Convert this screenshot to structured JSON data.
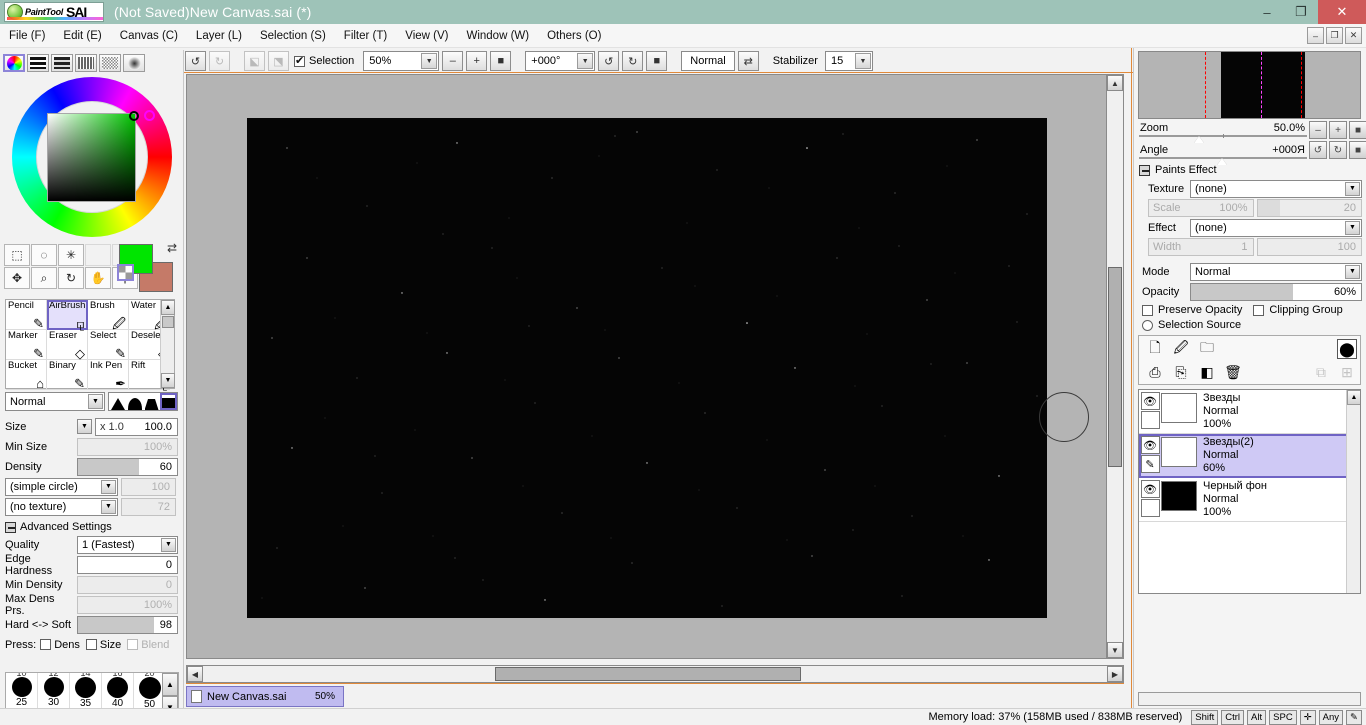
{
  "window": {
    "title": "(Not Saved)New Canvas.sai (*)",
    "logo_word1": "PaintTool",
    "logo_word2": "SAI",
    "minimize": "–",
    "maximize": "❐",
    "close": "✕"
  },
  "menu": [
    {
      "label": "File (F)",
      "name": "menu-file"
    },
    {
      "label": "Edit (E)",
      "name": "menu-edit"
    },
    {
      "label": "Canvas (C)",
      "name": "menu-canvas"
    },
    {
      "label": "Layer (L)",
      "name": "menu-layer"
    },
    {
      "label": "Selection (S)",
      "name": "menu-selection"
    },
    {
      "label": "Filter (T)",
      "name": "menu-filter"
    },
    {
      "label": "View (V)",
      "name": "menu-view"
    },
    {
      "label": "Window (W)",
      "name": "menu-window"
    },
    {
      "label": "Others (O)",
      "name": "menu-others"
    }
  ],
  "doc_buttons": [
    "–",
    "❐",
    "✕"
  ],
  "toolbar": {
    "undo": "↺",
    "redo": "↻",
    "sel_undo": "⬕",
    "sel_redo": "⬔",
    "selection_label": "Selection",
    "selection_checked": true,
    "zoom_value": "50%",
    "zoom_out": "–",
    "zoom_in": "+",
    "zoom_reset": "■",
    "angle_value": "+000°",
    "rotate_ccw": "↺",
    "rotate_cw": "↻",
    "angle_reset": "■",
    "view_mode": "Normal",
    "flip": "⇄",
    "stabilizer_label": "Stabilizer",
    "stabilizer_value": "15"
  },
  "left_panel": {
    "mini_tools": [
      {
        "name": "color-wheel-icon",
        "glyph": "◉",
        "selected": true
      },
      {
        "name": "rgb-sliders-icon",
        "glyph": "▤",
        "selected": false
      },
      {
        "name": "hsv-sliders-icon",
        "glyph": "▥",
        "selected": false
      },
      {
        "name": "color-mixer-icon",
        "glyph": "▦",
        "selected": false
      },
      {
        "name": "swatches-icon",
        "glyph": "▩",
        "selected": false
      },
      {
        "name": "scratchpad-icon",
        "glyph": "◍",
        "selected": false
      }
    ],
    "colors": {
      "foreground": "#00e500",
      "background": "#c57a68",
      "swap_glyph": "⇄"
    },
    "tools_row1": [
      {
        "name": "rect-select-tool",
        "glyph": "⬚"
      },
      {
        "name": "lasso-select-tool",
        "glyph": "༄"
      },
      {
        "name": "magic-wand-tool",
        "glyph": "✨"
      },
      {
        "name": "empty-slot-1",
        "glyph": ""
      },
      {
        "name": "empty-slot-2",
        "glyph": ""
      }
    ],
    "tools_row2": [
      {
        "name": "move-tool",
        "glyph": "✥"
      },
      {
        "name": "zoom-tool",
        "glyph": "🔍"
      },
      {
        "name": "rotate-tool",
        "glyph": "↻"
      },
      {
        "name": "hand-tool",
        "glyph": "✋"
      },
      {
        "name": "eyedropper-tool",
        "glyph": "⚲"
      }
    ],
    "brushes": [
      {
        "label": "Pencil",
        "glyph": "✎",
        "selected": false
      },
      {
        "label": "AirBrush",
        "glyph": "⚚",
        "selected": true
      },
      {
        "label": "Brush",
        "glyph": "🖌",
        "selected": false
      },
      {
        "label": "Water",
        "glyph": "💧",
        "selected": false
      },
      {
        "label": "Marker",
        "glyph": "✏",
        "selected": false
      },
      {
        "label": "Eraser",
        "glyph": "◇",
        "selected": false
      },
      {
        "label": "Select",
        "glyph": "✎",
        "selected": false
      },
      {
        "label": "Deselect",
        "glyph": "◈",
        "selected": false
      },
      {
        "label": "Bucket",
        "glyph": "⛾",
        "selected": false
      },
      {
        "label": "Binary",
        "glyph": "✎",
        "selected": false
      },
      {
        "label": "Ink Pen",
        "glyph": "✒",
        "selected": false
      },
      {
        "label": "Rift",
        "glyph": "⚚",
        "selected": false
      }
    ],
    "blend_mode": "Normal",
    "shapes": [
      "triangle",
      "bell",
      "trapezoid",
      "square"
    ],
    "shape_selected_index": 3,
    "params": [
      {
        "label": "Size",
        "prefix": "x 1.0",
        "value": "100.0",
        "disabled": false,
        "type": "value"
      },
      {
        "label": "Min Size",
        "prefix": "",
        "value": "100%",
        "disabled": true,
        "type": "value"
      },
      {
        "label": "Density",
        "prefix": "",
        "value": "60",
        "disabled": false,
        "type": "slider",
        "fill_pct": 62
      }
    ],
    "shape_select": "(simple circle)",
    "shape_select_value": "100",
    "texture_select": "(no texture)",
    "texture_select_value": "72",
    "advanced_label": "Advanced Settings",
    "advanced": [
      {
        "label": "Quality",
        "value": "1 (Fastest)",
        "type": "combo",
        "disabled": false
      },
      {
        "label": "Edge Hardness",
        "value": "0",
        "type": "slider",
        "disabled": false,
        "fill_pct": 0
      },
      {
        "label": "Min Density",
        "value": "0",
        "type": "slider",
        "disabled": true,
        "fill_pct": 0
      },
      {
        "label": "Max Dens Prs.",
        "value": "100%",
        "type": "slider",
        "disabled": true,
        "fill_pct": 0
      },
      {
        "label": "Hard <-> Soft",
        "value": "98",
        "type": "slider",
        "disabled": false,
        "fill_pct": 77
      }
    ],
    "press_label": "Press:",
    "press_options": [
      {
        "label": "Dens",
        "checked": false,
        "disabled": false
      },
      {
        "label": "Size",
        "checked": false,
        "disabled": false
      },
      {
        "label": "Blend",
        "checked": false,
        "disabled": true
      }
    ],
    "size_presets": [
      {
        "top": "10",
        "label": "25",
        "dot": 18
      },
      {
        "top": "12",
        "label": "30",
        "dot": 18
      },
      {
        "top": "14",
        "label": "35",
        "dot": 18
      },
      {
        "top": "16",
        "label": "40",
        "dot": 18
      },
      {
        "top": "20",
        "label": "50",
        "dot": 18
      }
    ]
  },
  "canvas": {
    "brush_cursor": "circle-cursor"
  },
  "tab": {
    "file_icon": "document-icon",
    "name": "New Canvas.sai",
    "zoom": "50%"
  },
  "right_panel": {
    "navigator": {
      "zoom_label": "Zoom",
      "zoom_value": "50.0%",
      "angle_label": "Angle",
      "angle_value": "+000Я",
      "zoom_out": "–",
      "zoom_in": "+",
      "zoom_reset": "■",
      "rot_ccw": "↺",
      "rot_cw": "↻",
      "rot_reset": "■"
    },
    "paints_effect": {
      "title": "Paints Effect",
      "texture_label": "Texture",
      "texture_value": "(none)",
      "scale_label": "Scale",
      "scale_value": "100%",
      "scale_num": "20",
      "effect_label": "Effect",
      "effect_value": "(none)",
      "width_label": "Width",
      "width_value": "1",
      "width_num": "100"
    },
    "layer_props": {
      "mode_label": "Mode",
      "mode_value": "Normal",
      "opacity_label": "Opacity",
      "opacity_value": "60%",
      "opacity_pct": 60,
      "preserve_opacity": "Preserve Opacity",
      "clipping_group": "Clipping Group",
      "selection_source": "Selection Source"
    },
    "layer_buttons": [
      {
        "name": "new-layer-button",
        "glyph": "🗋"
      },
      {
        "name": "new-linework-layer-button",
        "glyph": "🖉"
      },
      {
        "name": "new-folder-button",
        "glyph": "🗀"
      },
      {
        "name": "layer-mask-button",
        "glyph": "⬤"
      },
      {
        "name": "duplicate-layer-button",
        "glyph": "⎘"
      },
      {
        "name": "merge-down-button",
        "glyph": "⤓"
      },
      {
        "name": "clear-layer-button",
        "glyph": "◧"
      },
      {
        "name": "delete-layer-button",
        "glyph": "🗑"
      },
      {
        "name": "merge-group-button",
        "glyph": "⧉"
      },
      {
        "name": "add-to-group-button",
        "glyph": "⊞"
      }
    ],
    "layers": [
      {
        "name": "Звезды",
        "mode": "Normal",
        "opacity": "100%",
        "visible": true,
        "selected": false,
        "thumb": "#ffffff",
        "has_pen": false
      },
      {
        "name": "Звезды(2)",
        "mode": "Normal",
        "opacity": "60%",
        "visible": true,
        "selected": true,
        "thumb": "#ffffff",
        "has_pen": true
      },
      {
        "name": "Черный фон",
        "mode": "Normal",
        "opacity": "100%",
        "visible": true,
        "selected": false,
        "thumb": "#000000",
        "has_pen": false
      }
    ]
  },
  "status": {
    "memory": "Memory load: 37% (158MB used / 838MB reserved)",
    "modifiers": [
      "Shift",
      "Ctrl",
      "Alt",
      "SPC",
      "✛",
      "Any",
      "✎"
    ]
  }
}
